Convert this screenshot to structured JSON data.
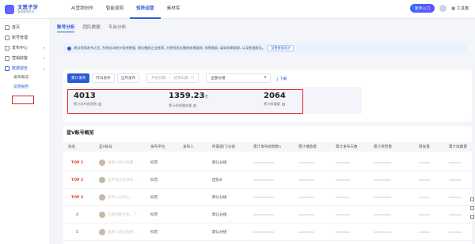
{
  "brand": {
    "title": "文思子牙",
    "subtitle": "营销管理系统"
  },
  "nav": [
    "AI营销创作",
    "智能混剪",
    "矩阵运营",
    "素材库"
  ],
  "nav_active": 2,
  "top_right": {
    "badge": "新手入门",
    "tool": "工具箱"
  },
  "sidebar": {
    "items": [
      {
        "label": "首页"
      },
      {
        "label": "账号管理"
      },
      {
        "label": "发布中心"
      },
      {
        "label": "营销获客"
      },
      {
        "label": "数据报告"
      }
    ],
    "sub_items": [
      "发布概况",
      "运营报告"
    ],
    "active_sub": 1
  },
  "tabs": [
    "账号分析",
    "团队数据",
    "平台分析"
  ],
  "notice": {
    "text": "建议视频发布之后, 系统自动统计相关数据, 建议播放企业推荐, 方便您团队播放效果跟踪, 效果跟踪, 媒体效果跟踪, 以及数据报告。",
    "link": "设置数据同步"
  },
  "filters": {
    "buttons": [
      "累计发布",
      "昨日发布",
      "当月发布"
    ],
    "active": 0,
    "date_start": "开始日期",
    "date_sep": "~",
    "date_end": "结束日期",
    "select": "全部分组",
    "download": "下载"
  },
  "stats": [
    {
      "value": "4013",
      "unit": "",
      "label": "累计发布视频数"
    },
    {
      "value": "1359.23",
      "unit": "万",
      "label": "累计视频播放量"
    },
    {
      "value": "2064",
      "unit": "",
      "label": "累计收藏量"
    }
  ],
  "table": {
    "title": "蓝V账号概览",
    "headers": [
      "排名",
      "蓝V账号",
      "发布平台",
      "发布人",
      "所属部门/分组",
      "累计发布视频数↓",
      "累计播放量",
      "累计发布天数",
      "累计获赞量",
      "转发量",
      "累计收藏量"
    ],
    "rows": [
      {
        "rank": "TOP 1",
        "account": "福来人说伙会肥...",
        "platform": "抖音",
        "publisher": "",
        "group": "默认分组",
        "top": true
      },
      {
        "rank": "TOP 2",
        "account": "伍叶坊立体培训...",
        "platform": "抖音",
        "publisher": "",
        "group": "团队8",
        "top": true
      },
      {
        "rank": "TOP 3",
        "account": "京中心公司之...",
        "platform": "抖音",
        "publisher": "",
        "group": "默认分组",
        "top": true
      },
      {
        "rank": "4",
        "account": "方便在配合金... 广",
        "platform": "抖音",
        "publisher": "",
        "group": "默认分组",
        "top": false
      },
      {
        "rank": "5",
        "account": "福来人说伙会肥...",
        "platform": "抖音",
        "publisher": "",
        "group": "默认分组",
        "top": false
      }
    ]
  },
  "colors": {
    "accent": "#2a5bd7",
    "highlight": "#d9262b",
    "top_rank": "#e5322d"
  }
}
